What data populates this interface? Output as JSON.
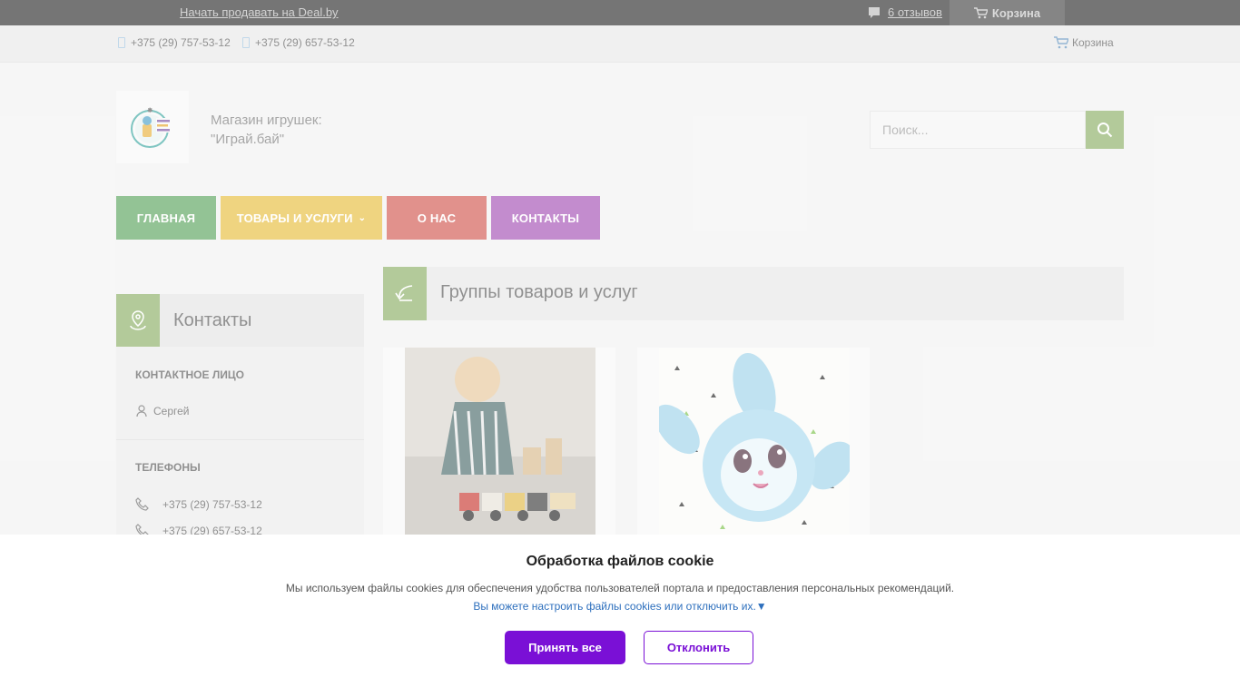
{
  "topbar": {
    "sell_link": "Начать продавать на Deal.by",
    "reviews": "6 отзывов",
    "cart": "Корзина"
  },
  "phonebar": {
    "phone1": "+375 (29) 757-53-12",
    "phone2": "+375 (29) 657-53-12",
    "cart": "Корзина"
  },
  "shop": {
    "name_line1": "Магазин игрушек:",
    "name_line2": "\"Играй.бай\""
  },
  "search": {
    "placeholder": "Поиск..."
  },
  "menu": {
    "home": "ГЛАВНАЯ",
    "products": "ТОВАРЫ И УСЛУГИ",
    "about": "О НАС",
    "contacts": "КОНТАКТЫ"
  },
  "groups": {
    "title": "Группы товаров и услуг"
  },
  "sidebar": {
    "title": "Контакты",
    "contact_label": "КОНТАКТНОЕ ЛИЦО",
    "contact_name": "Сергей",
    "phones_label": "ТЕЛЕФОНЫ",
    "phones": [
      "+375 (29) 757-53-12",
      "+375 (29) 657-53-12"
    ]
  },
  "cookie": {
    "title": "Обработка файлов cookie",
    "text": "Мы используем файлы cookies для обеспечения удобства пользователей портала и предоставления персональных рекомендаций.",
    "link": "Вы можете настроить файлы cookies или отключить их.▼",
    "accept": "Принять все",
    "decline": "Отклонить"
  },
  "colors": {
    "accent_green": "#8bae64",
    "menu_home": "#5aa35c",
    "menu_products": "#e7bd3c",
    "menu_about": "#d2574f",
    "menu_contacts": "#a34fb4",
    "cookie_button": "#7a10d6"
  }
}
